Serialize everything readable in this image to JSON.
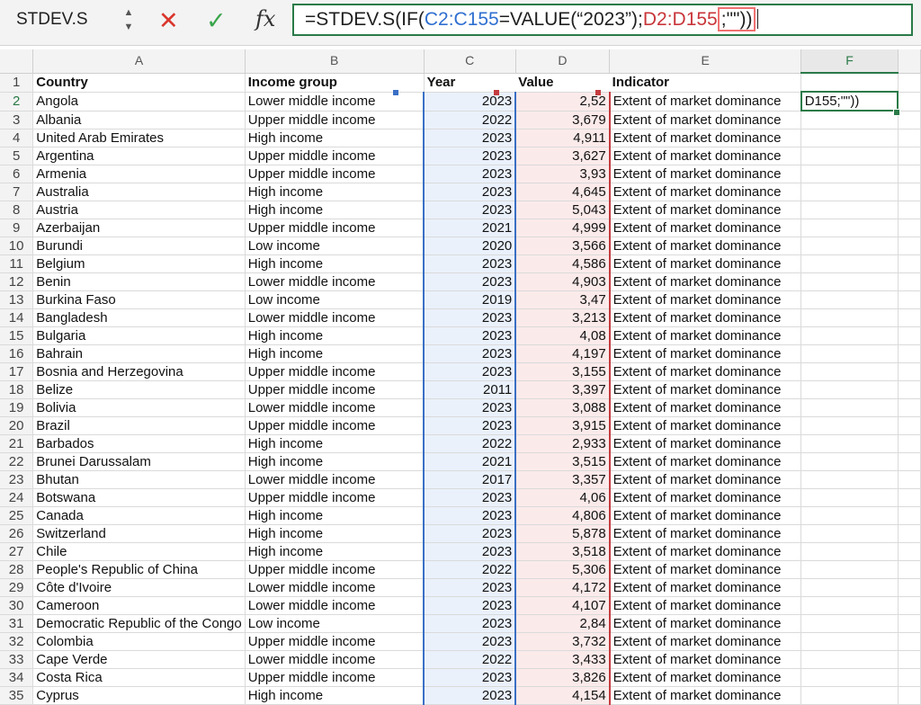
{
  "formula_bar": {
    "name_box": "STDEV.S",
    "cancel_glyph": "✕",
    "confirm_glyph": "✓",
    "fx_label": "fx",
    "formula_parts": {
      "p1": "=STDEV.S(IF(",
      "p2": "C2:C155",
      "p3": "=VALUE(“2023”);",
      "p4": "D2:D155",
      "p5": ";\"\")",
      "p6": ")"
    }
  },
  "columns": [
    "A",
    "B",
    "C",
    "D",
    "E",
    "F"
  ],
  "selected_column": "F",
  "header_row": {
    "country": "Country",
    "income": "Income group",
    "year": "Year",
    "value": "Value",
    "indicator": "Indicator",
    "f": "D155;\"\"))"
  },
  "active_cell_text": "D155;\"\"))",
  "indicator_text": "Extent of market dominance",
  "rows": [
    {
      "n": "2",
      "country": "Angola",
      "income": "Lower middle income",
      "year": "2023",
      "value": "2,52"
    },
    {
      "n": "3",
      "country": "Albania",
      "income": "Upper middle income",
      "year": "2022",
      "value": "3,679"
    },
    {
      "n": "4",
      "country": "United Arab Emirates",
      "income": "High income",
      "year": "2023",
      "value": "4,911"
    },
    {
      "n": "5",
      "country": "Argentina",
      "income": "Upper middle income",
      "year": "2023",
      "value": "3,627"
    },
    {
      "n": "6",
      "country": "Armenia",
      "income": "Upper middle income",
      "year": "2023",
      "value": "3,93"
    },
    {
      "n": "7",
      "country": "Australia",
      "income": "High income",
      "year": "2023",
      "value": "4,645"
    },
    {
      "n": "8",
      "country": "Austria",
      "income": "High income",
      "year": "2023",
      "value": "5,043"
    },
    {
      "n": "9",
      "country": "Azerbaijan",
      "income": "Upper middle income",
      "year": "2021",
      "value": "4,999"
    },
    {
      "n": "10",
      "country": "Burundi",
      "income": "Low income",
      "year": "2020",
      "value": "3,566"
    },
    {
      "n": "11",
      "country": "Belgium",
      "income": "High income",
      "year": "2023",
      "value": "4,586"
    },
    {
      "n": "12",
      "country": "Benin",
      "income": "Lower middle income",
      "year": "2023",
      "value": "4,903"
    },
    {
      "n": "13",
      "country": "Burkina Faso",
      "income": "Low income",
      "year": "2019",
      "value": "3,47"
    },
    {
      "n": "14",
      "country": "Bangladesh",
      "income": "Lower middle income",
      "year": "2023",
      "value": "3,213"
    },
    {
      "n": "15",
      "country": "Bulgaria",
      "income": "High income",
      "year": "2023",
      "value": "4,08"
    },
    {
      "n": "16",
      "country": "Bahrain",
      "income": "High income",
      "year": "2023",
      "value": "4,197"
    },
    {
      "n": "17",
      "country": "Bosnia and Herzegovina",
      "income": "Upper middle income",
      "year": "2023",
      "value": "3,155"
    },
    {
      "n": "18",
      "country": "Belize",
      "income": "Upper middle income",
      "year": "2011",
      "value": "3,397"
    },
    {
      "n": "19",
      "country": "Bolivia",
      "income": "Lower middle income",
      "year": "2023",
      "value": "3,088"
    },
    {
      "n": "20",
      "country": "Brazil",
      "income": "Upper middle income",
      "year": "2023",
      "value": "3,915"
    },
    {
      "n": "21",
      "country": "Barbados",
      "income": "High income",
      "year": "2022",
      "value": "2,933"
    },
    {
      "n": "22",
      "country": "Brunei Darussalam",
      "income": "High income",
      "year": "2021",
      "value": "3,515"
    },
    {
      "n": "23",
      "country": "Bhutan",
      "income": "Lower middle income",
      "year": "2017",
      "value": "3,357"
    },
    {
      "n": "24",
      "country": "Botswana",
      "income": "Upper middle income",
      "year": "2023",
      "value": "4,06"
    },
    {
      "n": "25",
      "country": "Canada",
      "income": "High income",
      "year": "2023",
      "value": "4,806"
    },
    {
      "n": "26",
      "country": "Switzerland",
      "income": "High income",
      "year": "2023",
      "value": "5,878"
    },
    {
      "n": "27",
      "country": "Chile",
      "income": "High income",
      "year": "2023",
      "value": "3,518"
    },
    {
      "n": "28",
      "country": "People's Republic of China",
      "income": "Upper middle income",
      "year": "2022",
      "value": "5,306"
    },
    {
      "n": "29",
      "country": "Côte d'Ivoire",
      "income": "Lower middle income",
      "year": "2023",
      "value": "4,172"
    },
    {
      "n": "30",
      "country": "Cameroon",
      "income": "Lower middle income",
      "year": "2023",
      "value": "4,107"
    },
    {
      "n": "31",
      "country": "Democratic Republic of the Congo",
      "income": "Low income",
      "year": "2023",
      "value": "2,84"
    },
    {
      "n": "32",
      "country": "Colombia",
      "income": "Upper middle income",
      "year": "2023",
      "value": "3,732"
    },
    {
      "n": "33",
      "country": "Cape Verde",
      "income": "Lower middle income",
      "year": "2022",
      "value": "3,433"
    },
    {
      "n": "34",
      "country": "Costa Rica",
      "income": "Upper middle income",
      "year": "2023",
      "value": "3,826"
    },
    {
      "n": "35",
      "country": "Cyprus",
      "income": "High income",
      "year": "2023",
      "value": "4,154"
    }
  ],
  "colors": {
    "year_range": "#3a6fc5",
    "value_range": "#c43c40",
    "active_cell": "#2a7a48",
    "cancel": "#d9352c",
    "confirm": "#3aa54b"
  }
}
